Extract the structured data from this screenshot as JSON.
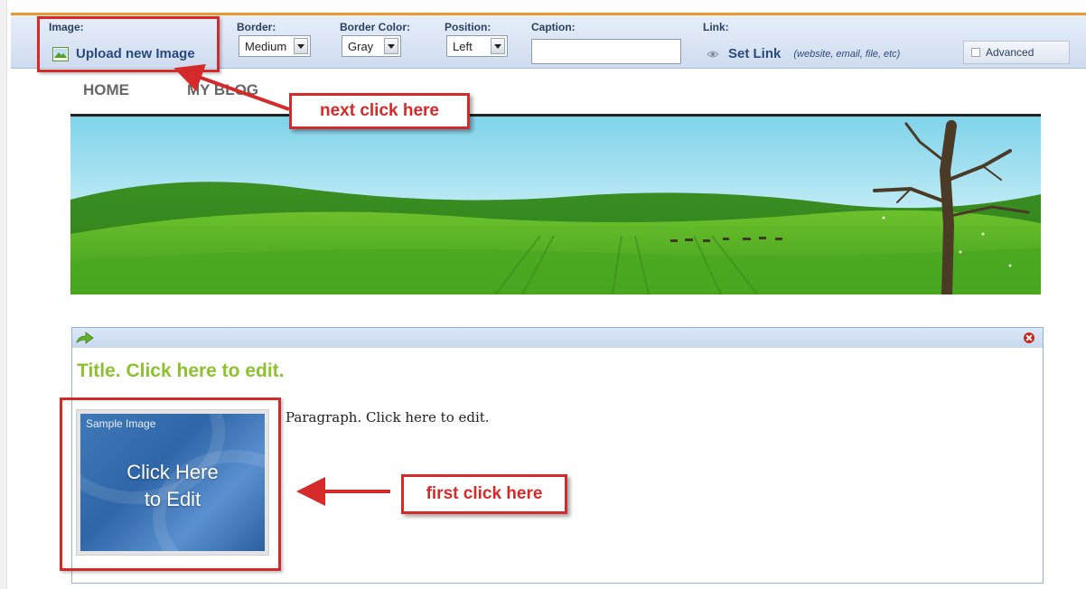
{
  "toolbar": {
    "image_label": "Image:",
    "upload_label": "Upload new Image",
    "border_label": "Border:",
    "border_value": "Medium",
    "border_color_label": "Border Color:",
    "border_color_value": "Gray",
    "position_label": "Position:",
    "position_value": "Left",
    "caption_label": "Caption:",
    "caption_value": "",
    "link_label": "Link:",
    "set_link_label": "Set Link",
    "set_link_hint": "(website, email, file, etc)",
    "advanced_label": "Advanced"
  },
  "nav": {
    "items": [
      "HOME",
      "MY BLOG"
    ]
  },
  "content": {
    "title": "Title. Click here to edit.",
    "paragraph": "Paragraph. Click here to edit.",
    "sample_image_label": "Sample Image",
    "sample_image_cta_line1": "Click Here",
    "sample_image_cta_line2": "to Edit"
  },
  "annotations": {
    "next": "next click here",
    "first": "first click here"
  },
  "colors": {
    "annotation_red": "#d52a2a",
    "title_green": "#8ec12f",
    "toolbar_accent": "#e89a2e",
    "link_blue": "#2a4a7e"
  },
  "icons": [
    "image-icon",
    "eye-icon",
    "move-arrow-icon",
    "close-icon",
    "dropdown-arrow-icon"
  ]
}
